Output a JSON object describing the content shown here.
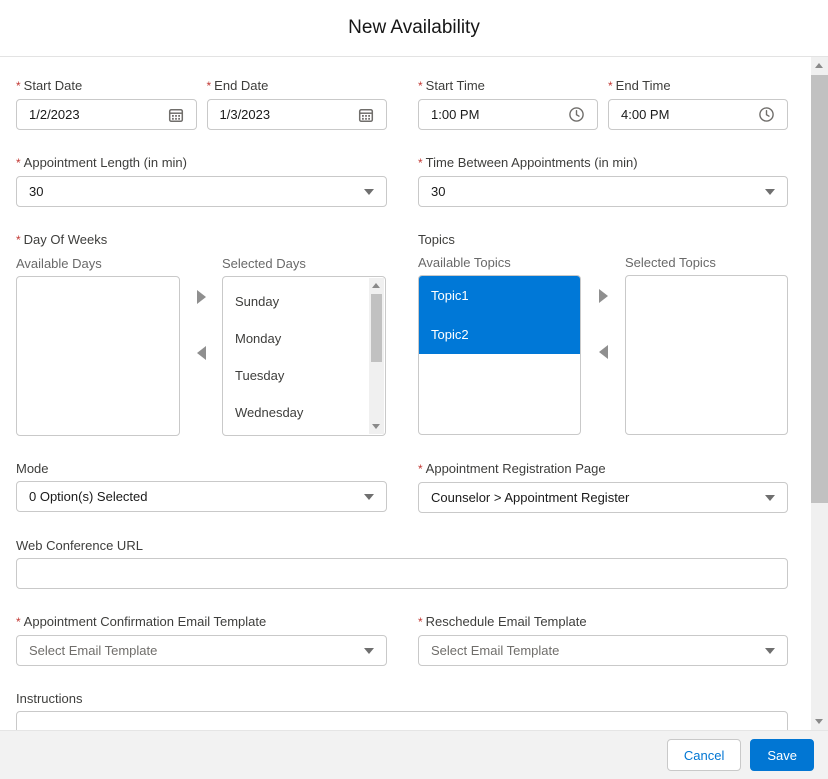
{
  "ui": {
    "required_marker": "*",
    "colors": {
      "accent_blue": "#0176d3",
      "selection_blue": "#0078d7",
      "required_red": "#c23934",
      "scrollbar_thumb": "#c1c1c1",
      "scrollbar_track": "#f0f0f0"
    },
    "icons": {
      "date_fields": "calendar-icon",
      "time_fields": "clock-icon",
      "comboboxes": "chevron-down-icon",
      "dual_list": [
        "move-right-arrow-icon",
        "move-left-arrow-icon"
      ],
      "scrollbars": [
        "up-arrow-icon",
        "down-arrow-icon"
      ]
    }
  },
  "modal": {
    "title": "New Availability"
  },
  "form": {
    "start_date": {
      "label": "Start Date",
      "value": "1/2/2023",
      "required": true
    },
    "end_date": {
      "label": "End Date",
      "value": "1/3/2023",
      "required": true
    },
    "start_time": {
      "label": "Start Time",
      "value": "1:00 PM",
      "required": true
    },
    "end_time": {
      "label": "End Time",
      "value": "4:00 PM",
      "required": true
    },
    "appointment_length": {
      "label": "Appointment Length (in min)",
      "value": "30",
      "required": true
    },
    "time_between_appointments": {
      "label": "Time Between Appointments (in min)",
      "value": "30",
      "required": true
    },
    "day_of_weeks": {
      "label": "Day Of Weeks",
      "required": true,
      "available_label": "Available Days",
      "selected_label": "Selected Days",
      "available": [],
      "selected": [
        "Sunday",
        "Monday",
        "Tuesday",
        "Wednesday"
      ]
    },
    "topics": {
      "label": "Topics",
      "available_label": "Available Topics",
      "selected_label": "Selected Topics",
      "available": [
        "Topic1",
        "Topic2"
      ],
      "available_highlighted": true,
      "selected": []
    },
    "mode": {
      "label": "Mode",
      "value": "0 Option(s) Selected"
    },
    "appointment_registration_page": {
      "label": "Appointment Registration Page",
      "value": "Counselor > Appointment Register",
      "required": true
    },
    "web_conference_url": {
      "label": "Web Conference URL",
      "value": ""
    },
    "appointment_confirmation_email_template": {
      "label": "Appointment Confirmation Email Template",
      "placeholder": "Select Email Template",
      "required": true
    },
    "reschedule_email_template": {
      "label": "Reschedule Email Template",
      "placeholder": "Select Email Template",
      "required": true
    },
    "instructions": {
      "label": "Instructions",
      "value": ""
    }
  },
  "footer": {
    "cancel_label": "Cancel",
    "save_label": "Save"
  }
}
